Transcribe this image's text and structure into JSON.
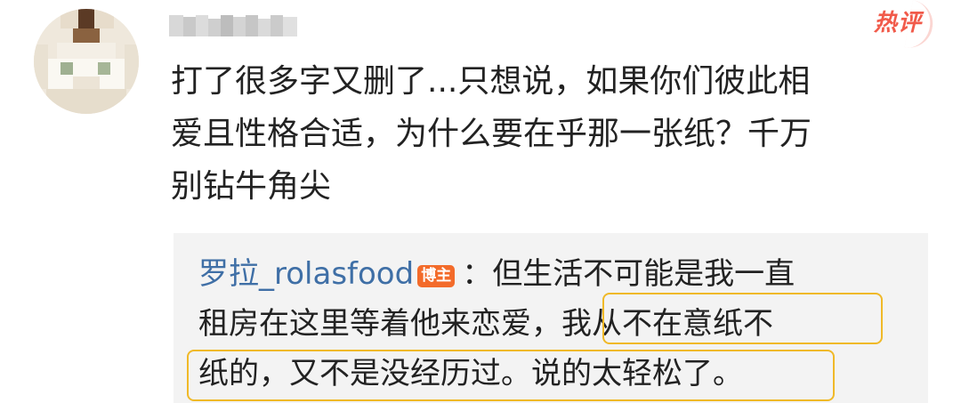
{
  "header": {
    "hot_badge": "热评"
  },
  "comment": {
    "lines": [
      "打了很多字又删了...只想说，如果你们彼此相",
      "爱且性格合适，为什么要在乎那一张纸？千万",
      "别钻牛角尖"
    ]
  },
  "reply": {
    "author": "罗拉_rolasfood",
    "author_badge": "博主",
    "separator": "：",
    "line1": "但生活不可能是我一直",
    "line2_plain": "租房在这里等着他来恋爱，",
    "line2_highlight": "我从不在意纸不",
    "line3_highlight": "纸的，又不是没经历过。说的太轻松了。"
  },
  "colors": {
    "hot_badge": "#f15a4a",
    "author_link": "#3f6fa6",
    "blogger_badge": "#f36b2a",
    "highlight_box": "#f0b928",
    "reply_background": "#f3f3f3"
  }
}
